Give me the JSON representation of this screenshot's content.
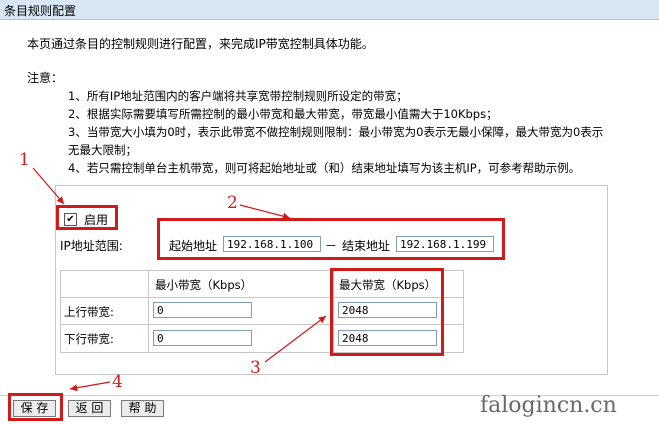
{
  "window": {
    "title": "条目规则配置"
  },
  "intro": "本页通过条目的控制规则进行配置，来完成IP带宽控制具体功能。",
  "notes": {
    "label": "注意：",
    "items": [
      "1、所有IP地址范围内的客户端将共享宽带控制规则所设定的带宽；",
      "2、根据实际需要填写所需控制的最小带宽和最大带宽，带宽最小值需大于10Kbps；",
      "3、当带宽大小填为0时，表示此带宽不做控制规则限制：最小带宽为0表示无最小保障，最大带宽为0表示",
      "无最大限制；",
      "4、若只需控制单台主机带宽，则可将起始地址或（和）结束地址填写为该主机IP，可参考帮助示例。"
    ]
  },
  "form": {
    "enable_label": "启用",
    "enable_checked": true,
    "ip_range_label": "IP地址范围:",
    "start_label": "起始地址",
    "start_ip": "192.168.1.100",
    "separator": "－",
    "end_label": "结束地址",
    "end_ip": "192.168.1.199",
    "table": {
      "col_min": "最小带宽（Kbps）",
      "col_max": "最大带宽（Kbps）",
      "rows": [
        {
          "label": "上行带宽:",
          "min": "0",
          "max": "2048"
        },
        {
          "label": "下行带宽:",
          "min": "0",
          "max": "2048"
        }
      ]
    }
  },
  "buttons": {
    "save": "保 存",
    "back": "返 回",
    "help": "帮 助"
  },
  "annotations": {
    "n1": "1",
    "n2": "2",
    "n3": "3",
    "n4": "4",
    "color": "#d11a1a"
  },
  "watermark": "falogincn.cn"
}
